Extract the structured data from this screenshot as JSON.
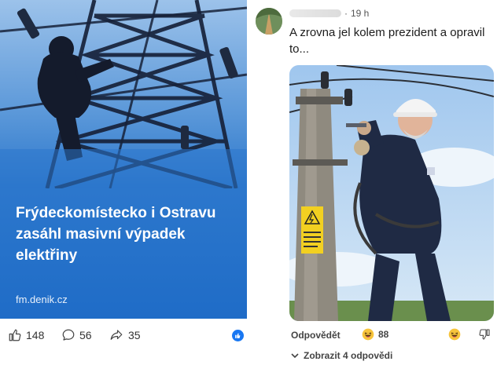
{
  "post": {
    "headline": "Frýdeckomístecko i Ostravu zasáhl masivní výpadek elektřiny",
    "source": "fm.denik.cz",
    "likes": "148",
    "comments": "56",
    "shares": "35"
  },
  "comment": {
    "time": "19 h",
    "text": "A zrovna jel kolem prezident a opravil to...",
    "reply_label": "Odpovědět",
    "reaction_count": "88",
    "show_replies_label": "Zobrazit 4 odpovědi"
  },
  "icons": {
    "like": "thumbs-up-icon",
    "comment": "speech-bubble-icon",
    "share": "share-arrow-icon",
    "reaction": "laughing-emoji-icon",
    "dislike": "thumbs-down-icon",
    "expand": "chevron-down-icon"
  },
  "colors": {
    "card_blue": "#2c77cc",
    "fb_blue": "#1877f2",
    "emoji_yellow": "#f7c43c"
  }
}
